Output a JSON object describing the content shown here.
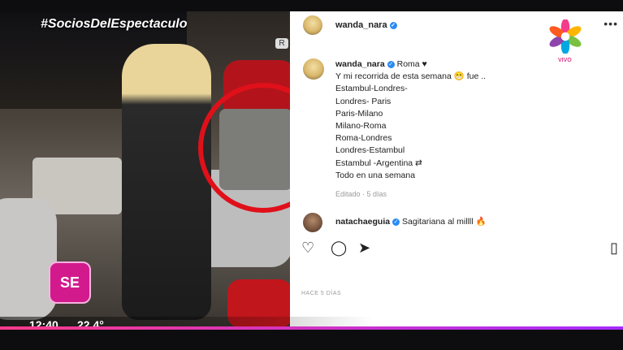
{
  "overlay": {
    "hashtag": "#SociosDelEspectaculo",
    "logo_text": "SE",
    "seat_badge": "R",
    "time": "12:40",
    "temperature": "22.4°",
    "vivo_label": "VIVO"
  },
  "post": {
    "header_username": "wanda_nara",
    "author": "wanda_nara",
    "location": "Roma ♥",
    "caption_lines": [
      "Y mi recorrida de esta semana 😁 fue ..",
      "Estambul-Londres-",
      "Londres- Paris",
      "Paris-Milano",
      "Milano-Roma",
      "Roma-Londres",
      "Londres-Estambul",
      "Estambul -Argentina ⇄",
      "Todo en una semana"
    ],
    "edited_label": "Editado · 5 días",
    "comment_user": "natachaeguia",
    "comment_text": "Sagitariana al millll 🔥",
    "time_ago": "HACE 5 DÍAS"
  },
  "colors": {
    "highlight_circle": "#e0101a",
    "verified": "#2a8af6",
    "brand_pink": "#d21a8c"
  },
  "icons": [
    "heart-icon",
    "comment-icon",
    "share-icon",
    "bookmark-icon",
    "more-options-icon",
    "verified-icon",
    "channel-logo-icon"
  ]
}
